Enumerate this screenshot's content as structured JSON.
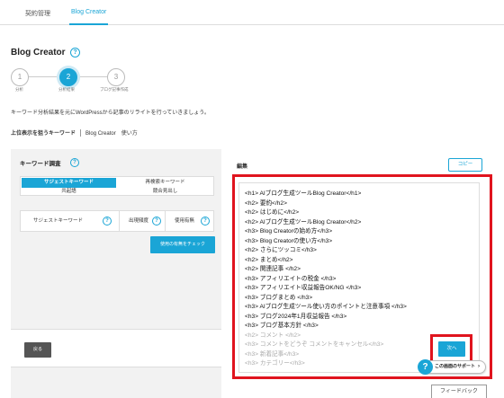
{
  "tabs": [
    {
      "label": "契約管理"
    },
    {
      "label": "Blog Creator"
    }
  ],
  "page": {
    "title": "Blog Creator",
    "help": "?"
  },
  "steps": [
    {
      "number": "1",
      "label": "分析"
    },
    {
      "number": "2",
      "label": "分析結果"
    },
    {
      "number": "3",
      "label": "ブログ記事作成"
    }
  ],
  "description": "キーワード分析結果を元にWordPressから記事のリライトを行っていきましょう。",
  "target_keyword": {
    "label": "上位表示を狙うキーワード",
    "value": "Blog Creator　使い方"
  },
  "keyword_research": {
    "title": "キーワード調査",
    "help": "?",
    "segments": [
      "サジェストキーワード",
      "共起語",
      "再検索キーワード",
      "競合見出し"
    ],
    "columns": [
      "サジェストキーワード",
      "出現頻度",
      "使用有無"
    ],
    "check_button": "使用の有無をチェック",
    "back_button": "戻る"
  },
  "editor": {
    "label": "編集",
    "copy_button": "コピー",
    "lines": [
      "<h1> AIブログ生成ツールBlog Creator</h1>",
      "<h2> 要約</h2>",
      "<h2> はじめに</h2>",
      "<h2> AIブログ生成ツールBlog Creator</h2>",
      "<h3> Blog Creatorの始め方</h3>",
      "<h3> Blog Creatorの使い方</h3>",
      "<h2> さらにツッコミ</h3>",
      "<h2> まとめ</h2>",
      "<h2> 関連記事 </h2>",
      "<h3> アフィリエイトの税金 </h3>",
      "<h3> アフィリエイト収益報告OK/NG </h3>",
      "<h3> ブログまとめ </h3>",
      "<h3> AIブログ生成ツール使い方のポイントと注意事項 </h3>",
      "<h3> ブログ2024年1月収益報告 </h3>",
      "<h3> ブログ基本方針 </h3>"
    ],
    "faded_lines": [
      "<h2> コメント </h2>",
      "<h3> コメントをどうぞ コメントをキャンセル</h3>",
      "<h3> 新着記事</h3>",
      "<h3> カテゴリー</h3>"
    ],
    "next_button": "次へ"
  },
  "support": {
    "label": "この画面のサポート",
    "icon": "question-icon"
  },
  "feedback": "フィードバック",
  "colors": {
    "accent": "#1aa5d6",
    "highlight": "#e0141e"
  }
}
